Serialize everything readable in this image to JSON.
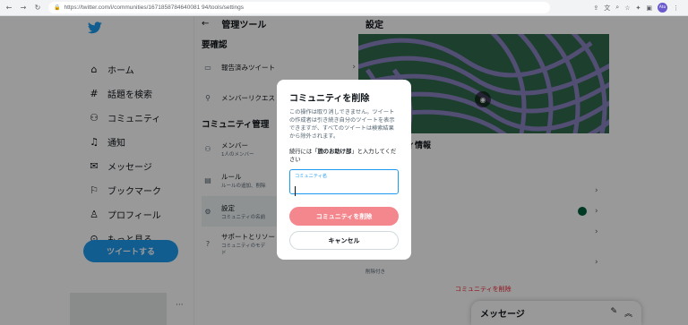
{
  "browser": {
    "url_host": "twitter.com",
    "url_path": "/i/communities/1671858784640081 94/tools/settings",
    "url_full": "https://twitter.com/i/communities/1671858784640081 94/tools/settings",
    "profile_initials": "Ato"
  },
  "sidebar": {
    "items": [
      {
        "icon": "home-icon",
        "label": "ホーム"
      },
      {
        "icon": "hashtag-icon",
        "label": "話題を検索"
      },
      {
        "icon": "community-icon",
        "label": "コミュニティ"
      },
      {
        "icon": "bell-icon",
        "label": "通知"
      },
      {
        "icon": "envelope-icon",
        "label": "メッセージ"
      },
      {
        "icon": "bookmark-icon",
        "label": "ブックマーク"
      },
      {
        "icon": "profile-icon",
        "label": "プロフィール"
      },
      {
        "icon": "more-icon",
        "label": "もっと見る"
      }
    ],
    "tweet_button": "ツイートする",
    "account_more": "···"
  },
  "mid": {
    "title": "管理ツール",
    "moderation_heading": "要確認",
    "reported_label": "報告済みツイート",
    "member_requests_label": "メンバーリクエス",
    "community_heading": "コミュニティ管理",
    "members_label": "メンバー",
    "members_sub": "1人のメンバー",
    "rules_label": "ルール",
    "rules_sub": "ルールの追加、削除",
    "settings_label": "設定",
    "settings_sub": "コミュニティの名前",
    "support_label": "サポートとリソー",
    "support_sub": "コミュニティのモデ",
    "support_sub2": "ド"
  },
  "right": {
    "title": "設定",
    "info_heading": "ィ情報",
    "small_text": "削除付き",
    "delete_link": "コミュニティを削除"
  },
  "messages": {
    "title": "メッセージ"
  },
  "modal": {
    "title": "コミュニティを削除",
    "description": "この操作は取り消しできません。ツイートの作成者は引き続き自分のツイートを表示できますが、すべてのツイートは検索結果から除外されます。",
    "instruction_prefix": "続行には「",
    "instruction_name": "旅のお助け部",
    "instruction_suffix": "」と入力してください",
    "field_label": "コミュニティ名",
    "field_value": "",
    "delete_button": "コミュニティを削除",
    "cancel_button": "キャンセル"
  },
  "colors": {
    "accent": "#1d9bf0",
    "danger": "#f4212e",
    "danger_disabled": "#f4868d",
    "banner_green": "#2f6a4e",
    "banner_purple": "#8a82c2"
  }
}
